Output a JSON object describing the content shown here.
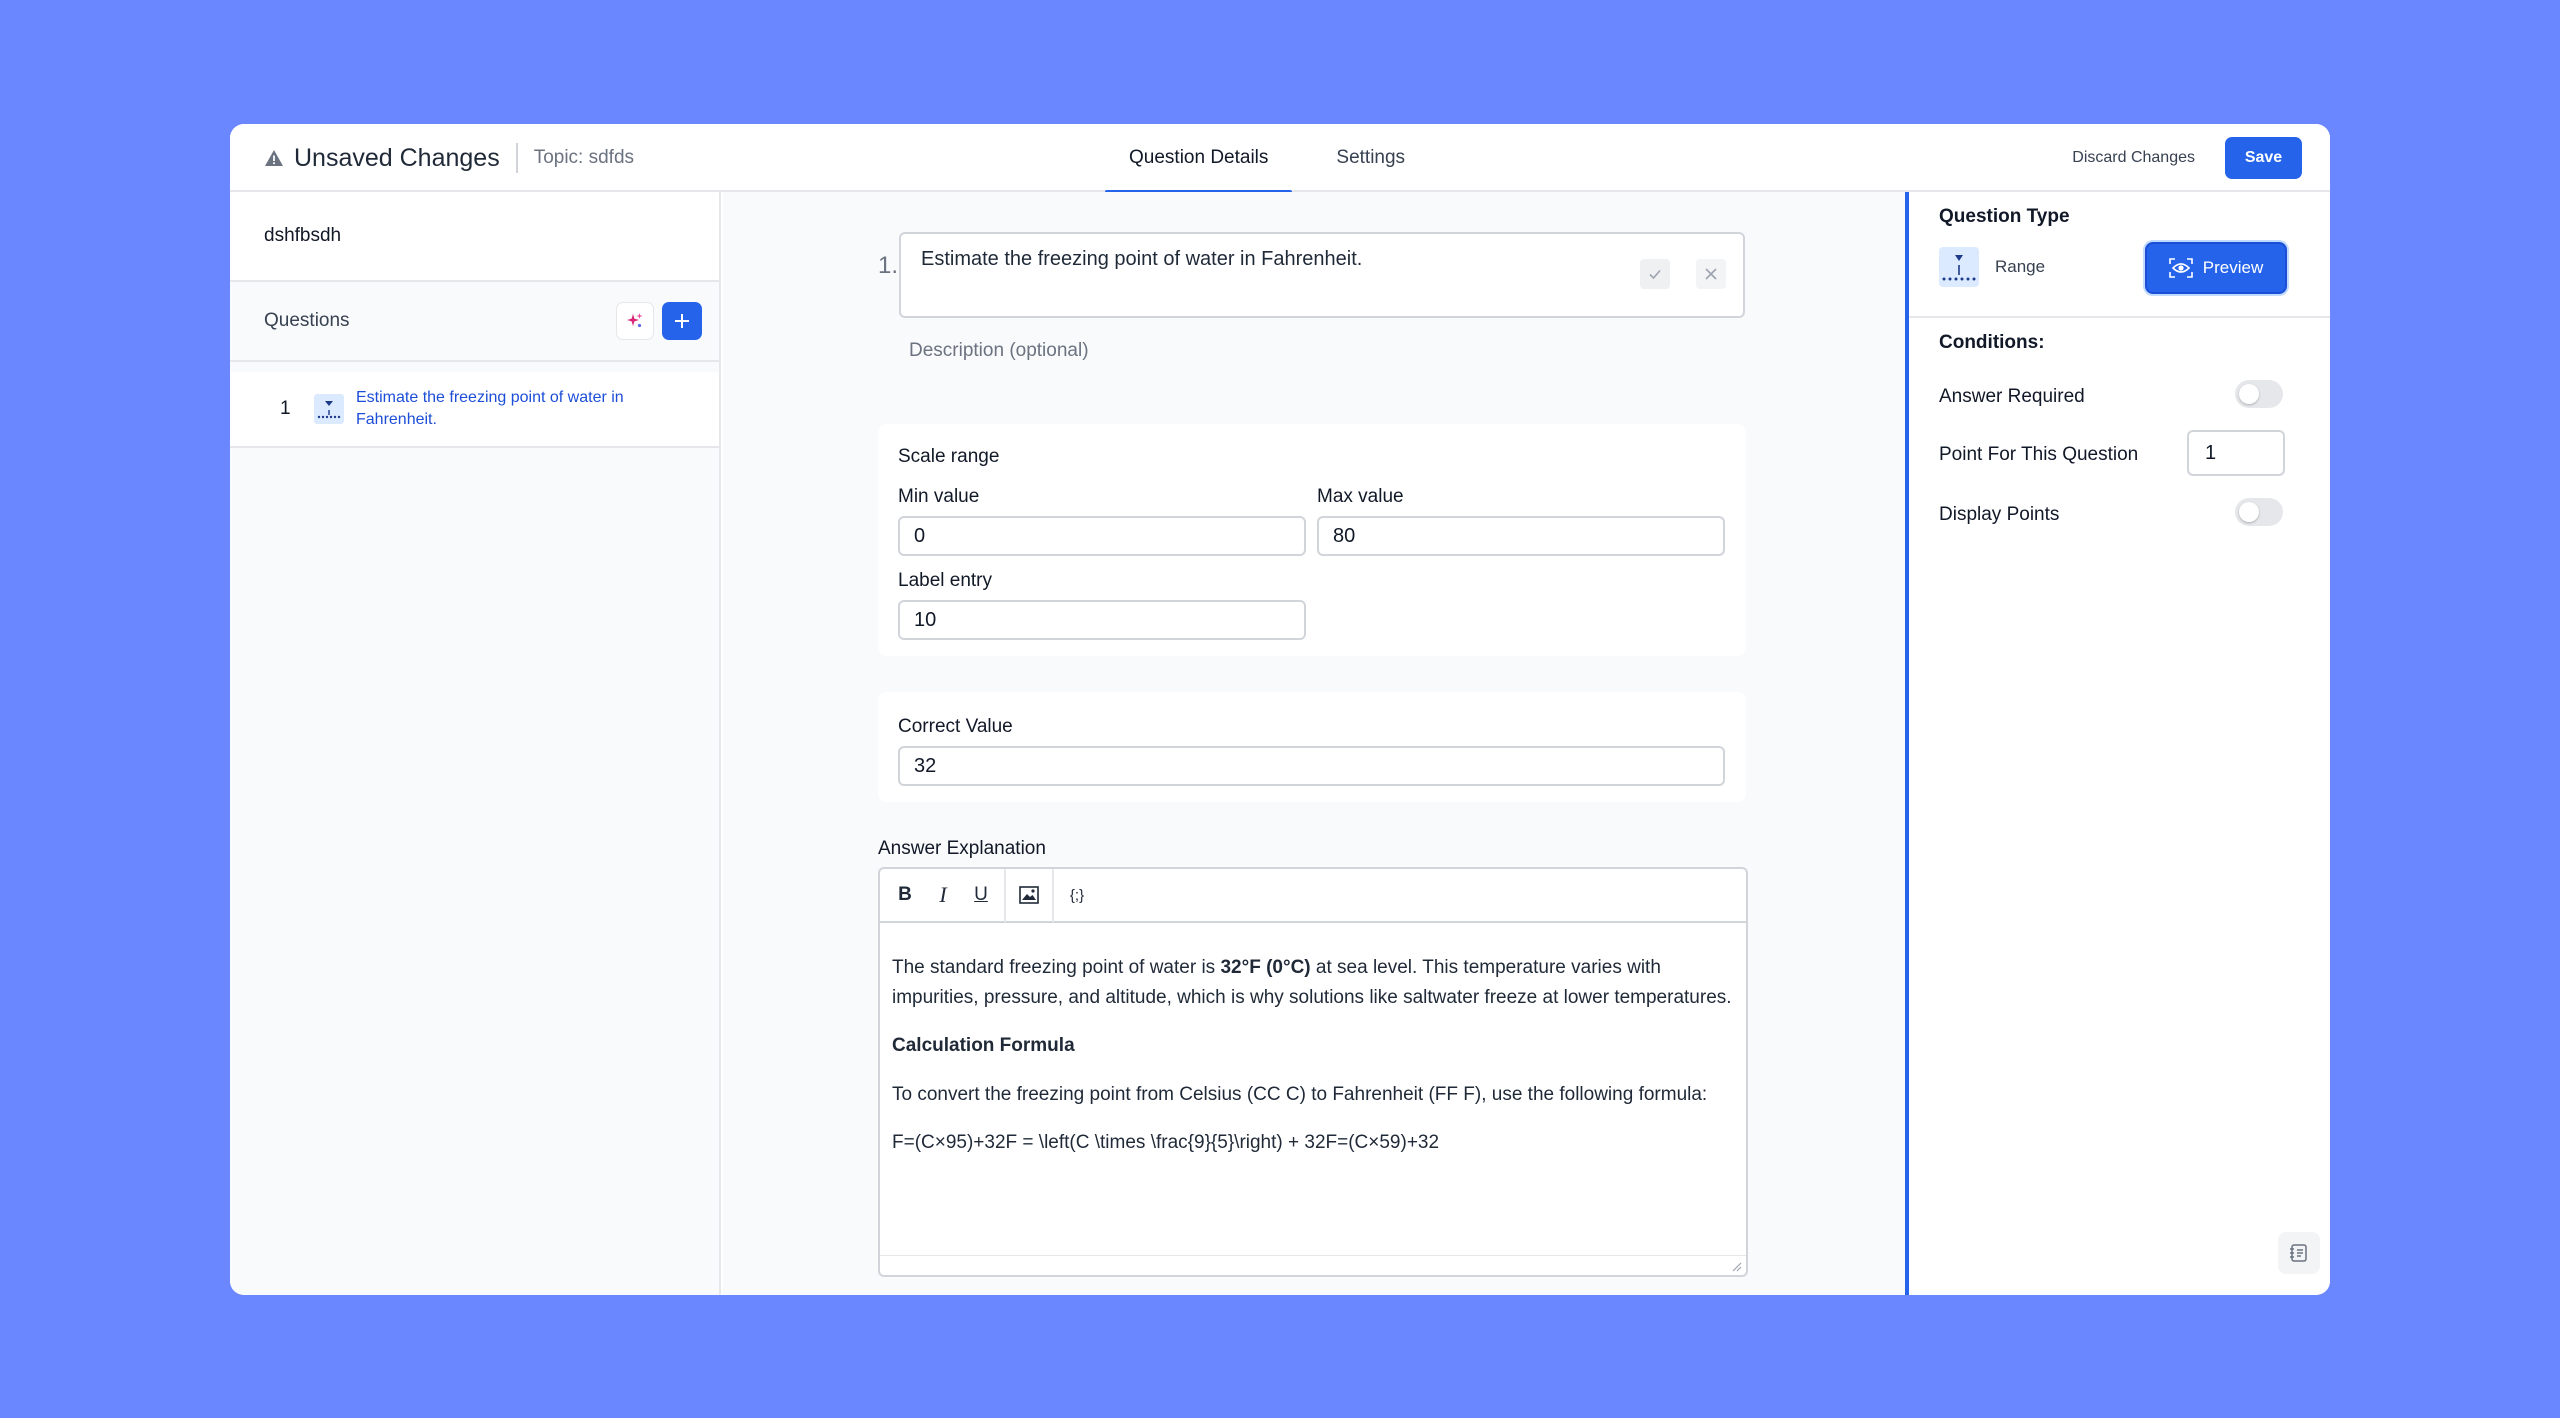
{
  "header": {
    "title": "Unsaved Changes",
    "topic": "Topic: sdfds",
    "tabs": [
      {
        "label": "Question Details",
        "active": true
      },
      {
        "label": "Settings",
        "active": false
      }
    ],
    "discard_label": "Discard Changes",
    "save_label": "Save"
  },
  "sidebar": {
    "name": "dshfbsdh",
    "questions_label": "Questions",
    "items": [
      {
        "number": "1",
        "text": "Estimate the freezing point of water in Fahrenheit."
      }
    ]
  },
  "editor": {
    "question_number": "1.",
    "question_text": "Estimate the freezing point of water in Fahrenheit.",
    "description_placeholder": "Description (optional)",
    "scale": {
      "heading": "Scale range",
      "min_label": "Min value",
      "min_value": "0",
      "max_label": "Max value",
      "max_value": "80",
      "label_entry_label": "Label entry",
      "label_entry_value": "10"
    },
    "correct": {
      "label": "Correct Value",
      "value": "32"
    },
    "explanation": {
      "label": "Answer Explanation",
      "toolbar": {
        "bold": "B",
        "italic": "I",
        "underline": "U",
        "code": "{;}"
      },
      "p1_before": "The standard freezing point of water is ",
      "p1_bold": "32°F (0°C)",
      "p1_after": " at sea level. This temperature varies with impurities, pressure, and altitude, which is why solutions like saltwater freeze at lower temperatures.",
      "h_formula": "Calculation Formula",
      "p2": "To convert the freezing point from Celsius (CC C) to Fahrenheit (FF F), use the following formula:",
      "p3": "F=(C×95)+32F = \\left(C \\times \\frac{9}{5}\\right) + 32F=(C×59)+32"
    }
  },
  "right_panel": {
    "question_type_label": "Question Type",
    "type_name": "Range",
    "preview_label": "Preview",
    "conditions_label": "Conditions:",
    "answer_required_label": "Answer Required",
    "answer_required": false,
    "points_label": "Point For This Question",
    "points_value": "1",
    "display_points_label": "Display Points",
    "display_points": false
  },
  "colors": {
    "background": "#6b87ff",
    "accent": "#2563eb",
    "link": "#1d4ed8"
  }
}
